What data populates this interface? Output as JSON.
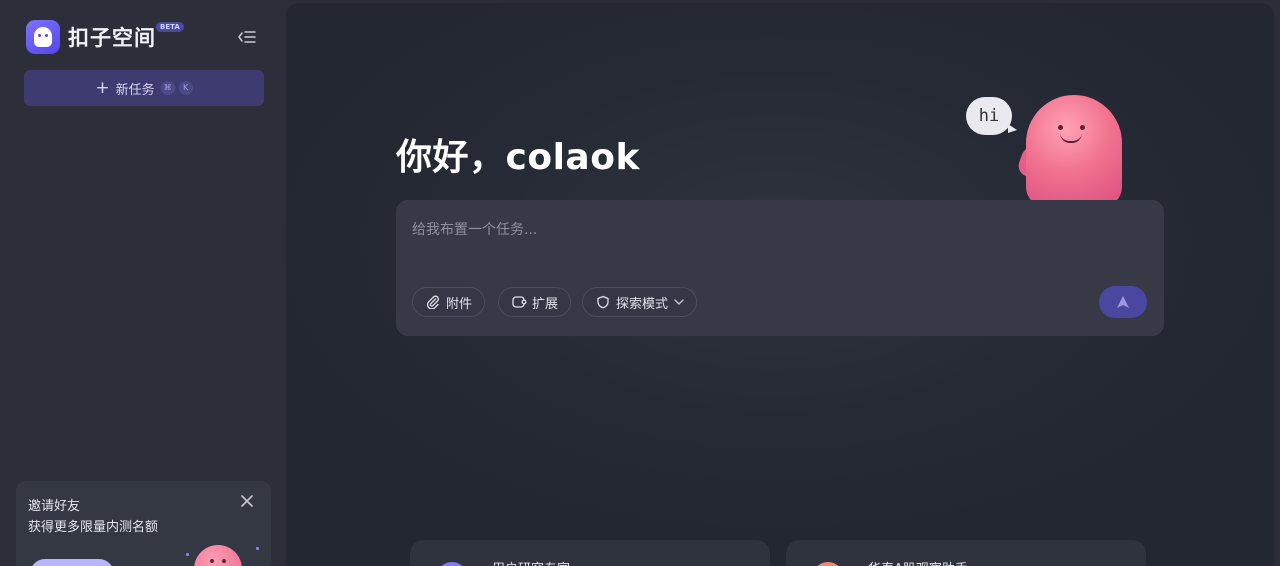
{
  "sidebar": {
    "brand_name": "扣子空间",
    "brand_badge": "BETA",
    "collapse_icon": "sidebar-collapse-icon",
    "new_task": {
      "label": "新任务",
      "shortcut_keys": [
        "⌘",
        "K"
      ]
    },
    "invite": {
      "title": "邀请好友",
      "subtitle": "获得更多限量内测名额",
      "close_icon": "close-icon"
    }
  },
  "main": {
    "greeting": "你好，colaok",
    "mascot_bubble": "hi",
    "composer": {
      "placeholder": "给我布置一个任务...",
      "value": "",
      "attach_label": "附件",
      "extend_label": "扩展",
      "mode_label": "探索模式",
      "send_icon": "send-arrow-icon"
    },
    "agent_cards": [
      {
        "name": "用户研究专家",
        "avatar_color": "#7f7cf0"
      },
      {
        "name": "华泰A股观察助手",
        "avatar_color": "#ef8a6a"
      }
    ]
  },
  "colors": {
    "accent": "#4a47a0",
    "new_task_bg": "#3e3b71",
    "sidebar_bg": "#2c2f39",
    "main_bg": "#262a34"
  }
}
